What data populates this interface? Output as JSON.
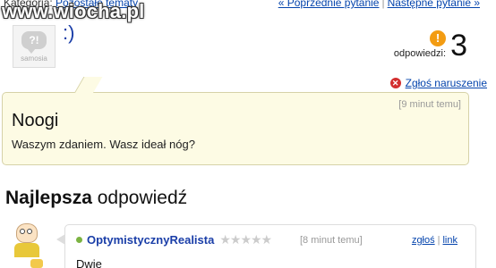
{
  "topbar": {
    "category_label": "Kategoria:",
    "category_link": "Pozostałe tematy",
    "prev_label": "« Poprzednie pytanie",
    "separator": "|",
    "next_label": "Następne pytanie »"
  },
  "watermark": "www.wiocha.pl",
  "question": {
    "avatar_brand": "samosia",
    "author_line": ":)",
    "answers_label": "odpowiedzi:",
    "answers_count": "3",
    "report_label": "Zgłoś naruszenie",
    "time": "[9 minut temu]",
    "title": "Noogi",
    "body": "Waszym zdaniem. Wasz ideał nóg?"
  },
  "best_answer": {
    "heading_bold": "Najlepsza",
    "heading_rest": " odpowiedź",
    "user": "OptymistycznyRealista",
    "stars": "★★★★★",
    "time": "[8 minut temu]",
    "report_link": "zgłoś",
    "separator": "|",
    "link_label": "link",
    "text": "Dwie"
  },
  "icons": {
    "warning": "warning-icon",
    "report": "report-icon",
    "online": "online-dot-icon"
  },
  "colors": {
    "link": "#0645ad",
    "question_bg": "#fdfbe4",
    "warning": "#f39c12",
    "report": "#d32f2f"
  }
}
